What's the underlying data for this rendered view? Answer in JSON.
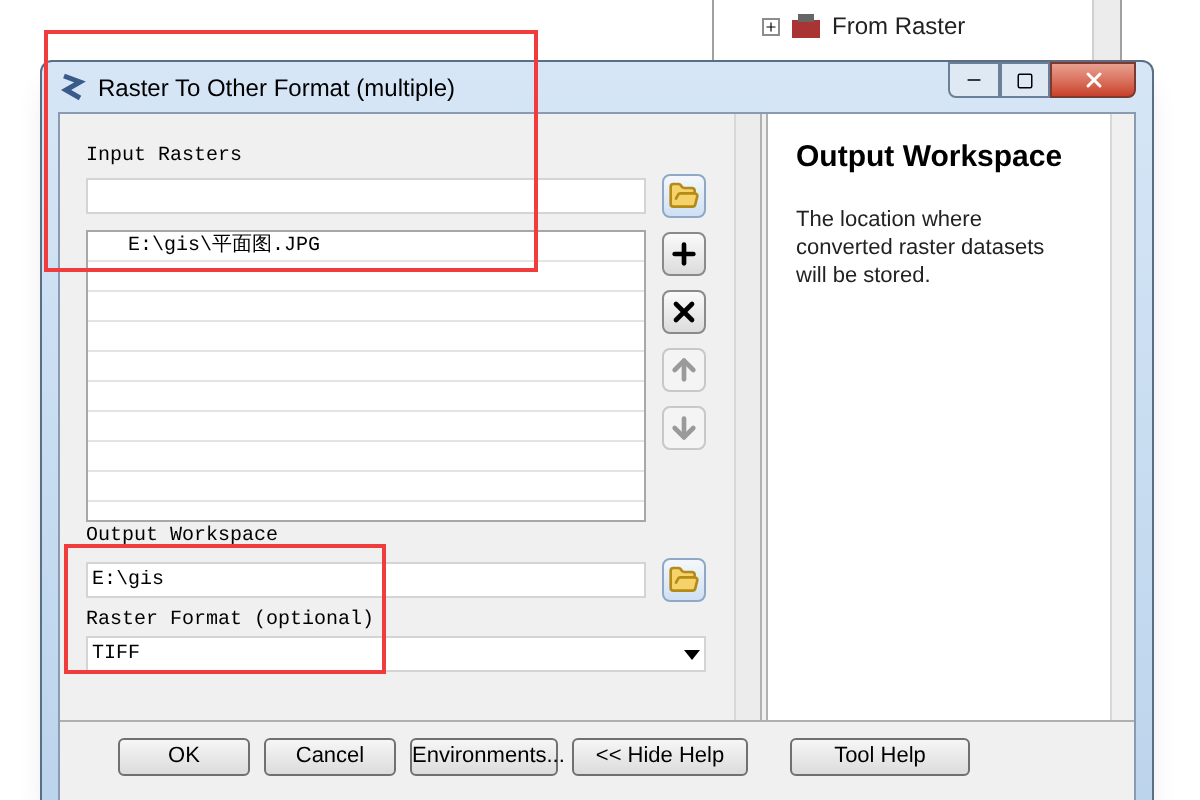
{
  "background_tree": {
    "items": [
      {
        "label": "From Raster",
        "expanded": false
      }
    ]
  },
  "dialog": {
    "title": "Raster To Other Format (multiple)",
    "input_rasters": {
      "label": "Input Rasters",
      "rows": [
        "E:\\gis\\平面图.JPG"
      ]
    },
    "list_buttons": [
      {
        "kind": "add",
        "disabled": false
      },
      {
        "kind": "remove",
        "disabled": false
      },
      {
        "kind": "up",
        "disabled": true
      },
      {
        "kind": "down",
        "disabled": true
      }
    ],
    "output_workspace": {
      "label": "Output Workspace",
      "value": "E:\\gis"
    },
    "raster_format": {
      "label": "Raster Format (optional)",
      "value": "TIFF"
    },
    "help": {
      "title": "Output Workspace",
      "text": "The location where converted raster datasets will be stored."
    },
    "buttons": [
      "OK",
      "Cancel",
      "Environments...",
      "<< Hide Help",
      "Tool Help"
    ]
  }
}
